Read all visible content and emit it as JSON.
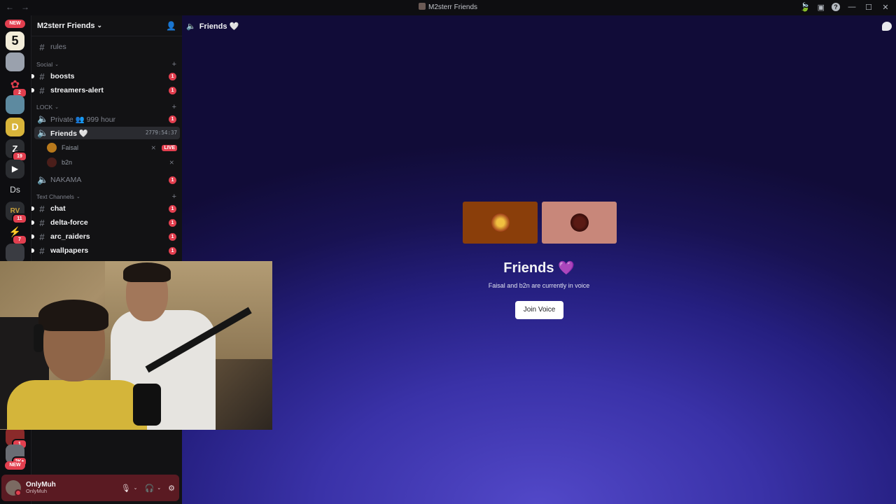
{
  "window": {
    "title": "M2sterr Friends",
    "back_glyph": "←",
    "forward_glyph": "→",
    "controls": {
      "minimize": "—",
      "maximize": "☐",
      "close": "✕",
      "help": "?"
    }
  },
  "server_rail": {
    "new_label_top": "NEW",
    "new_label_bottom": "NEW",
    "items": [
      {
        "name": "server-5",
        "glyph": "5",
        "color": "#f2ecd9"
      },
      {
        "name": "server-hoodie",
        "glyph": "",
        "color": "#9aa1ad"
      },
      {
        "name": "server-duck",
        "glyph": "🦆",
        "color": "#0e0e11",
        "badge": "2"
      },
      {
        "name": "server-avatar",
        "glyph": "",
        "color": "#5d8aa0"
      },
      {
        "name": "server-d",
        "glyph": "D",
        "color": "#d8b43a"
      },
      {
        "name": "server-z",
        "glyph": "Z",
        "color": "#2b2d31",
        "badge": "19"
      },
      {
        "name": "server-play",
        "glyph": "▶",
        "color": "#2b2d31"
      },
      {
        "name": "server-ds",
        "glyph": "Ds",
        "color": "#0e0e11"
      },
      {
        "name": "server-rv",
        "glyph": "RV",
        "color": "#2b2d31",
        "badge": "11"
      },
      {
        "name": "server-bolt",
        "glyph": "⚡",
        "color": "#0e0e11",
        "badge": "7"
      },
      {
        "name": "server-grey",
        "glyph": "",
        "color": "#3a3c42"
      },
      {
        "name": "server-red",
        "glyph": "",
        "color": "#8a2a2a",
        "badge": "1"
      },
      {
        "name": "server-2k",
        "glyph": "",
        "color": "#6a6d74",
        "badge": "2K+"
      }
    ]
  },
  "guild": {
    "name": "M2sterr Friends",
    "channels": {
      "rules": "rules",
      "cat_social": "Social",
      "boosts": "boosts",
      "streamers_alert": "streamers-alert",
      "cat_lock": "LOCK",
      "private": "Private 👥 999 hour",
      "friends": "Friends 🤍",
      "friends_timer": "2779:54:37",
      "voice_users": [
        {
          "name": "Faisal",
          "live": "LIVE"
        },
        {
          "name": "b2n"
        }
      ],
      "nakama": "NAKAMA",
      "cat_text": "Text Channels",
      "chat": "chat",
      "delta_force": "delta-force",
      "arc_raiders": "arc_raiders",
      "wallpapers": "wallpapers"
    },
    "mention_count": "1"
  },
  "user": {
    "name": "OnlyMuh",
    "tag": "OnlyMuh"
  },
  "main": {
    "header": "Friends",
    "header_heart": "🤍",
    "title": "Friends",
    "title_heart": "💜",
    "subtitle": "Faisal and b2n are currently in voice",
    "join_label": "Join Voice"
  },
  "colors": {
    "mention_red": "#e23f4f",
    "live_red": "#e23f4f",
    "tile_faisal": "#8a3e0a",
    "tile_b2n": "#c8877a"
  }
}
